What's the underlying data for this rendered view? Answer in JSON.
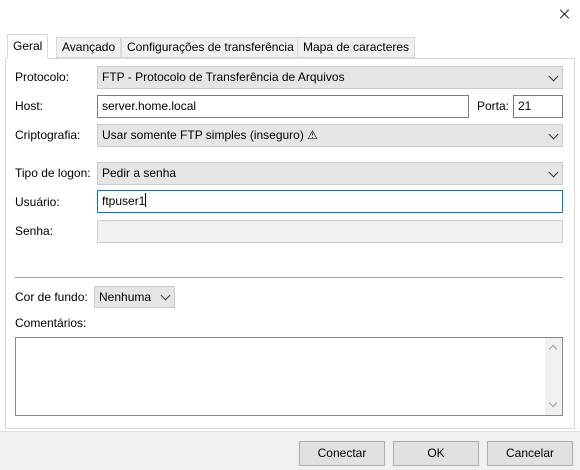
{
  "dialog": {
    "close_glyph": ""
  },
  "tabs": [
    {
      "label": "Geral"
    },
    {
      "label": "Avançado"
    },
    {
      "label": "Configurações de transferência"
    },
    {
      "label": "Mapa de caracteres"
    }
  ],
  "general": {
    "protocol": {
      "label": "Protocolo:",
      "value": "FTP - Protocolo de Transferência de Arquivos"
    },
    "host": {
      "label": "Host:",
      "value": "server.home.local"
    },
    "port": {
      "label": "Porta:",
      "value": "21"
    },
    "encryption": {
      "label": "Criptografia:",
      "value": "Usar somente FTP simples (inseguro) ⚠"
    },
    "logon_type": {
      "label": "Tipo de logon:",
      "value": "Pedir a senha"
    },
    "user": {
      "label": "Usuário:",
      "value": "ftpuser1"
    },
    "password": {
      "label": "Senha:",
      "value": ""
    },
    "background_color": {
      "label": "Cor de fundo:",
      "value": "Nenhuma"
    },
    "comments": {
      "label": "Comentários:",
      "value": ""
    }
  },
  "buttons": {
    "connect": "Conectar",
    "ok": "OK",
    "cancel": "Cancelar"
  },
  "colors": {
    "focus": "#0078d7",
    "combo_bg": "#e5e5e5",
    "footer_bg": "#f0f0f0"
  }
}
